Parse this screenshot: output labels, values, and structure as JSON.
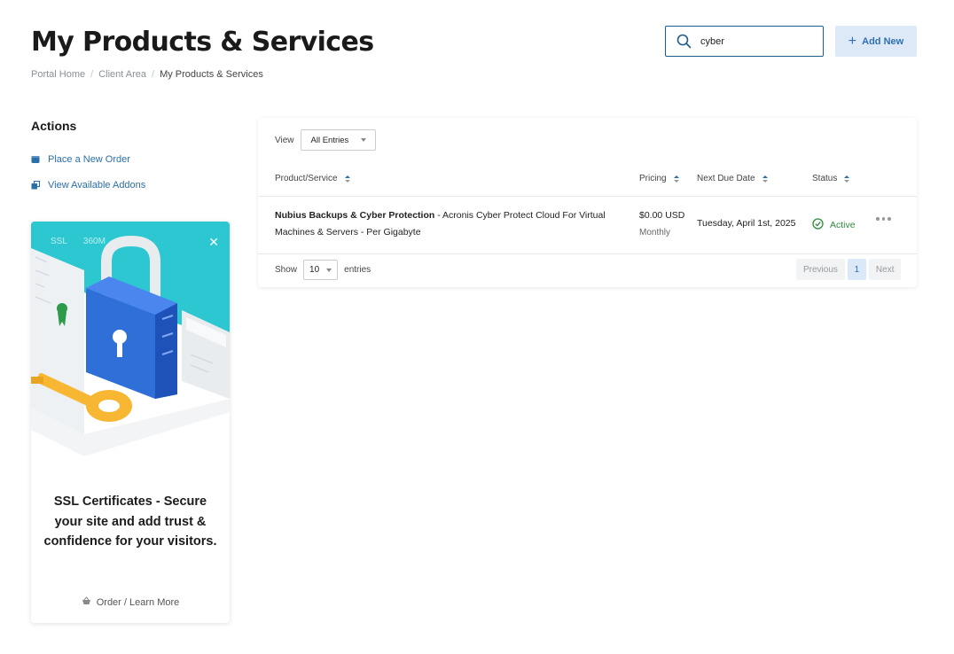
{
  "header": {
    "title": "My Products & Services",
    "search_value": "cyber",
    "add_new_label": "Add New"
  },
  "breadcrumb": [
    "Portal Home",
    "Client Area",
    "My Products & Services"
  ],
  "sidebar": {
    "actions_title": "Actions",
    "items": [
      {
        "label": "Place a New Order",
        "icon": "cart-icon"
      },
      {
        "label": "View Available Addons",
        "icon": "addons-icon"
      }
    ]
  },
  "promo": {
    "tags": [
      "SSL",
      "360M"
    ],
    "headline": "SSL Certificates - Secure your site and add trust & confidence for your visitors.",
    "learn_more": "Order / Learn More",
    "colors": {
      "teal": "#2cc7d0",
      "lock_blue": "#2f6fd8",
      "key_yellow": "#f7b733"
    }
  },
  "table": {
    "view_label": "View",
    "view_selected": "All Entries",
    "columns": [
      "Product/Service",
      "Pricing",
      "Next Due Date",
      "Status"
    ],
    "rows": [
      {
        "product_name": "Nubius Backups & Cyber Protection",
        "product_desc_1": " - Acronis Cyber Protect Cloud For Virtual",
        "product_desc_2": "Machines & Servers - Per Gigabyte",
        "price": "$0.00 USD",
        "cycle": "Monthly",
        "due": "Tuesday, April 1st, 2025",
        "status": "Active"
      }
    ],
    "show_label": "Show",
    "show_value": "10",
    "entries_label": "entries",
    "pager": {
      "previous": "Previous",
      "current": "1",
      "next": "Next"
    }
  },
  "colors": {
    "accent": "#2c6fa8",
    "active_status": "#2e8b3c"
  }
}
